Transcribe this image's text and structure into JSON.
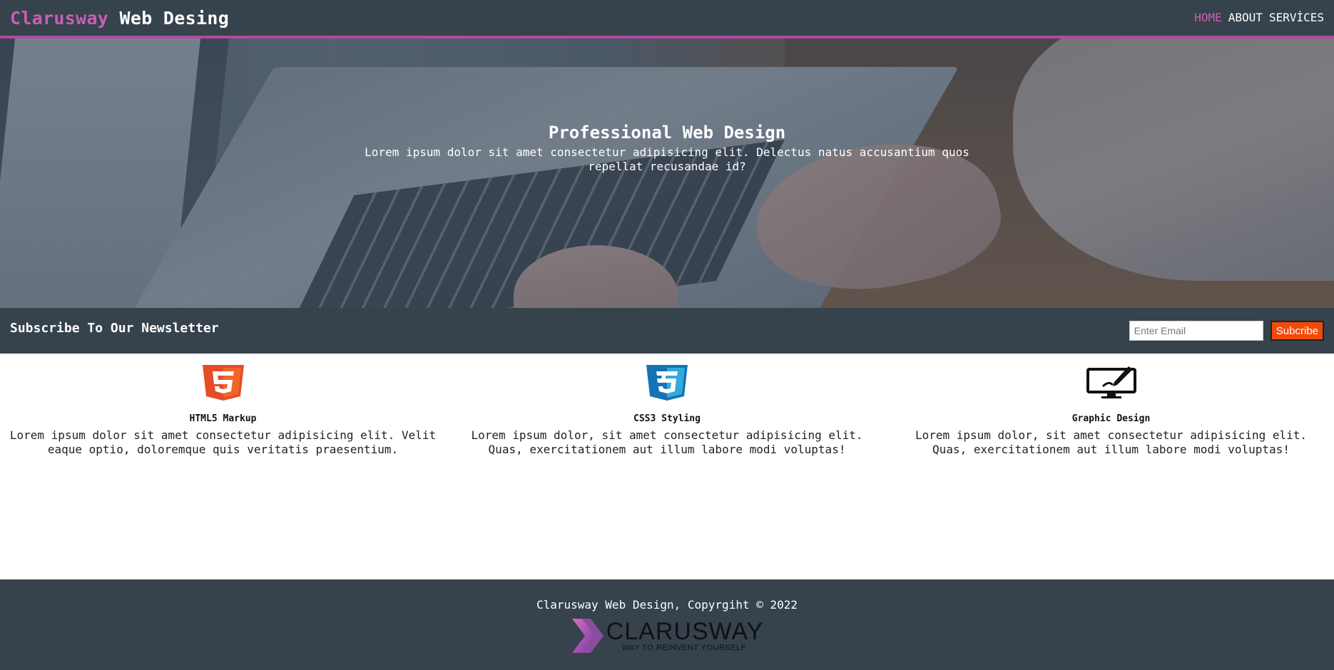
{
  "header": {
    "brand_part1": "Clarusway",
    "brand_part2": "Web Desing",
    "nav": [
      "HOME",
      "ABOUT",
      "SERVİCES"
    ]
  },
  "hero": {
    "title": "Professional Web Design",
    "description": "Lorem ipsum dolor sit amet consectetur adipisicing elit. Delectus natus accusantium quos repellat recusandae id?"
  },
  "newsletter": {
    "title": "Subscribe To Our Newsletter",
    "email_placeholder": "Enter Email",
    "button_label": "Subcribe"
  },
  "features": [
    {
      "icon": "html5-icon",
      "title": "HTML5 Markup",
      "description": "Lorem ipsum dolor sit amet consectetur adipisicing elit. Velit eaque optio, doloremque quis veritatis praesentium."
    },
    {
      "icon": "css3-icon",
      "title": "CSS3 Styling",
      "description": "Lorem ipsum dolor, sit amet consectetur adipisicing elit. Quas, exercitationem aut illum labore modi voluptas!"
    },
    {
      "icon": "graphic-design-monitor-icon",
      "title": "Graphic Design",
      "description": "Lorem ipsum dolor, sit amet consectetur adipisicing elit. Quas, exercitationem aut illum labore modi voluptas!"
    }
  ],
  "footer": {
    "copyright": "Clarusway Web Design, Copyrgiht © 2022",
    "logo_name": "CLARUSWAY",
    "logo_tagline": "WAY TO REINVENT YOURSELF"
  },
  "colors": {
    "header_bg": "#36424c",
    "accent": "#c85fb6",
    "subscribe_button": "#f24a0a",
    "html5_orange": "#e44d26",
    "css3_blue": "#1572b6"
  }
}
